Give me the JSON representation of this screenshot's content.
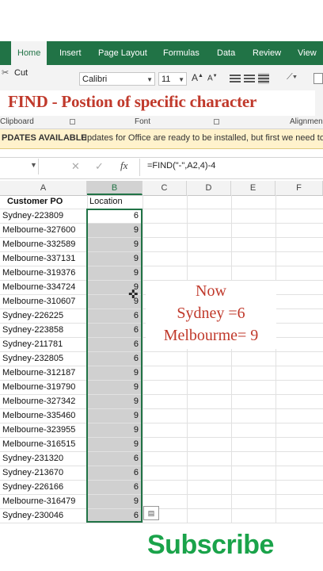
{
  "ribbon": {
    "tabs": [
      "Home",
      "Insert",
      "Page Layout",
      "Formulas",
      "Data",
      "Review",
      "View"
    ],
    "active_tab": "Home",
    "cut_label": "Cut",
    "font_name": "Calibri",
    "font_size": "11",
    "groups": [
      "Clipboard",
      "Font",
      "Alignmen"
    ]
  },
  "title_banner": "FIND - Postion of specific character",
  "message_bar": {
    "title": "PDATES AVAILABLE",
    "text": "Updates for Office are ready to be installed, but first we need to cl"
  },
  "formula_bar": {
    "formula": "=FIND(\"-\",A2,4)-4"
  },
  "columns": [
    "A",
    "B",
    "C",
    "D",
    "E",
    "F"
  ],
  "selected_column": "B",
  "table": {
    "headers": [
      "Customer PO",
      "Location"
    ],
    "rows": [
      [
        "Sydney-223809",
        "6"
      ],
      [
        "Melbourne-327600",
        "9"
      ],
      [
        "Melbourne-332589",
        "9"
      ],
      [
        "Melbourne-337131",
        "9"
      ],
      [
        "Melbourne-319376",
        "9"
      ],
      [
        "Melbourne-334724",
        "9"
      ],
      [
        "Melbourne-310607",
        "9"
      ],
      [
        "Sydney-226225",
        "6"
      ],
      [
        "Sydney-223858",
        "6"
      ],
      [
        "Sydney-211781",
        "6"
      ],
      [
        "Sydney-232805",
        "6"
      ],
      [
        "Melbourne-312187",
        "9"
      ],
      [
        "Melbourne-319790",
        "9"
      ],
      [
        "Melbourne-327342",
        "9"
      ],
      [
        "Melbourne-335460",
        "9"
      ],
      [
        "Melbourne-323955",
        "9"
      ],
      [
        "Melbourne-316515",
        "9"
      ],
      [
        "Sydney-231320",
        "6"
      ],
      [
        "Sydney-213670",
        "6"
      ],
      [
        "Sydney-226166",
        "6"
      ],
      [
        "Melbourne-316479",
        "9"
      ],
      [
        "Sydney-230046",
        "6"
      ]
    ]
  },
  "annotation": {
    "line1": "Now",
    "line2": "Sydney =6",
    "line3": "Melbourme= 9"
  },
  "subscribe_text": "Subscribe",
  "colors": {
    "excel_green": "#217346",
    "banner_red": "#c0392b",
    "subscribe_green": "#1aa34a",
    "message_bar": "#fff2cc"
  }
}
